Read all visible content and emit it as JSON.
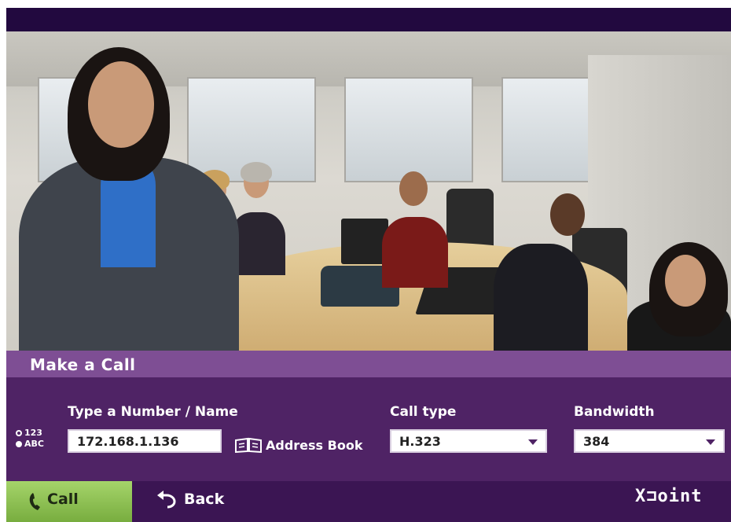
{
  "panel": {
    "title": "Make a Call",
    "input_modes": [
      {
        "label": "123",
        "selected": false
      },
      {
        "label": "ABC",
        "selected": true
      }
    ],
    "number_label": "Type a Number / Name",
    "number_value": "172.168.1.136",
    "address_book_label": "Address Book",
    "call_type_label": "Call type",
    "call_type_value": "H.323",
    "bandwidth_label": "Bandwidth",
    "bandwidth_value": "384"
  },
  "footer": {
    "call_label": "Call",
    "back_label": "Back",
    "logo_text": "X⊐oint"
  },
  "colors": {
    "panel": "#4f2365",
    "title_bar": "#7e4e94",
    "call_button": "#8fc255",
    "top_bar": "#22093f"
  }
}
